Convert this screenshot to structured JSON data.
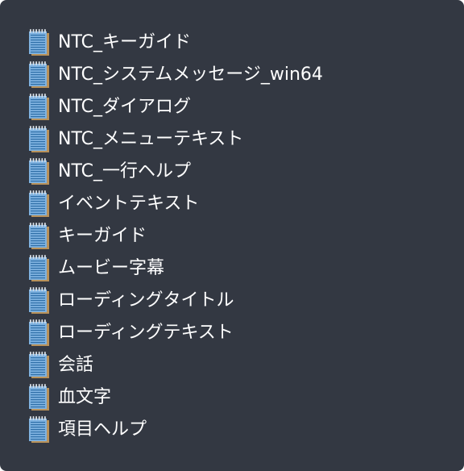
{
  "colors": {
    "background": "#333842",
    "text": "#ffffff",
    "icon_page": "#7fb2e0",
    "icon_lines": "#2f6fa8",
    "icon_spiral": "#d8dfe6",
    "icon_shadow": "#b9925a"
  },
  "files": {
    "icon": "notepad-icon",
    "items": [
      {
        "label": "NTC_キーガイド"
      },
      {
        "label": "NTC_システムメッセージ_win64"
      },
      {
        "label": "NTC_ダイアログ"
      },
      {
        "label": "NTC_メニューテキスト"
      },
      {
        "label": "NTC_一行ヘルプ"
      },
      {
        "label": "イベントテキスト"
      },
      {
        "label": "キーガイド"
      },
      {
        "label": "ムービー字幕"
      },
      {
        "label": "ローディングタイトル"
      },
      {
        "label": "ローディングテキスト"
      },
      {
        "label": "会話"
      },
      {
        "label": "血文字"
      },
      {
        "label": "項目ヘルプ"
      }
    ]
  }
}
